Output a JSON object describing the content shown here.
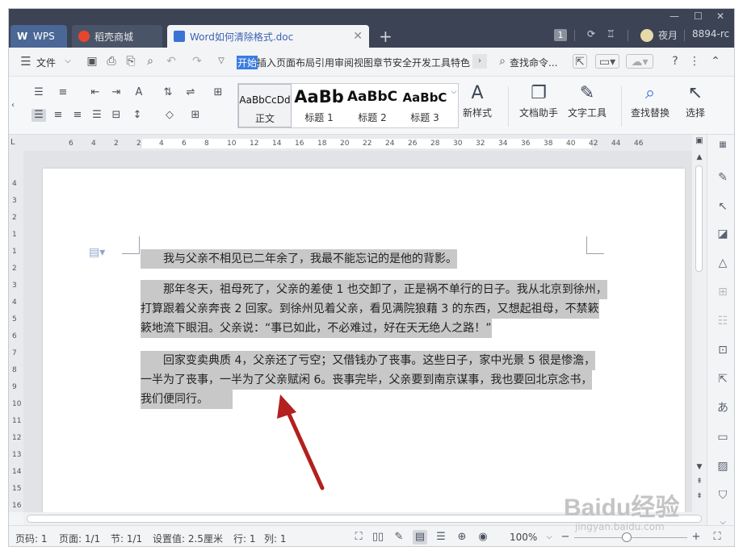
{
  "titlebar": {
    "tabs": [
      {
        "label": "WPS"
      },
      {
        "label": "稻壳商城"
      },
      {
        "label": "Word如何清除格式.doc"
      }
    ],
    "badge": "1",
    "user": "夜月",
    "account": "8894-rc"
  },
  "menubar": {
    "file_label": "文件",
    "tabs": [
      "开始",
      "插入",
      "页面布局",
      "引用",
      "审阅",
      "视图",
      "章节",
      "安全",
      "开发工具",
      "特色"
    ],
    "search_label": "查找命令..."
  },
  "ribbon": {
    "styles": [
      {
        "sample": "AaBbCcDd",
        "name": "正文"
      },
      {
        "sample": "AaBb",
        "name": "标题 1"
      },
      {
        "sample": "AaBbC",
        "name": "标题 2"
      },
      {
        "sample": "AaBbC",
        "name": "标题 3"
      }
    ],
    "new_style": "新样式",
    "doc_helper": "文档助手",
    "text_tools": "文字工具",
    "find_replace": "查找替换",
    "select": "选择"
  },
  "ruler": {
    "h_ticks": [
      "6",
      "4",
      "2",
      "2",
      "4",
      "6",
      "8",
      "10",
      "12",
      "14",
      "16",
      "18",
      "20",
      "22",
      "24",
      "26",
      "28",
      "30",
      "32",
      "34",
      "36",
      "38",
      "40",
      "42",
      "44",
      "46"
    ],
    "v_ticks": [
      "4",
      "3",
      "2",
      "1",
      "1",
      "2",
      "3",
      "4",
      "5",
      "6",
      "7",
      "8",
      "9",
      "10",
      "11",
      "12",
      "13",
      "14",
      "15",
      "16"
    ]
  },
  "document": {
    "p1": [
      "我与父亲不相见已二年余了，我最不能忘记的是他的背影。"
    ],
    "p2": [
      "那年冬天，祖母死了，父亲的差使 1 也交卸了，正是祸不单行的日子。我从北京到徐州，",
      "打算跟着父亲奔丧 2 回家。到徐州见着父亲，看见满院狼藉 3 的东西，又想起祖母，不禁簌",
      "簌地流下眼泪。父亲说：“事已如此，不必难过，好在天无绝人之路！”"
    ],
    "p3": [
      "回家变卖典质 4，父亲还了亏空；又借钱办了丧事。这些日子，家中光景 5 很是惨澹，",
      "一半为了丧事，一半为了父亲赋闲 6。丧事完毕，父亲要到南京谋事，我也要回北京念书，",
      "我们便同行。"
    ]
  },
  "statusbar": {
    "page_num": "页码: 1",
    "pages": "页面: 1/1",
    "section": "节: 1/1",
    "setting": "设置值: 2.5厘米",
    "row": "行: 1",
    "col": "列: 1",
    "zoom": "100%"
  },
  "watermark": {
    "brand": "Baidu经验",
    "site": "jingyan.baidu.com"
  },
  "colors": {
    "accent": "#3b7de0",
    "titlebar": "#3b4355",
    "arrow": "#b3201d",
    "selection": "#c8c8c8"
  }
}
